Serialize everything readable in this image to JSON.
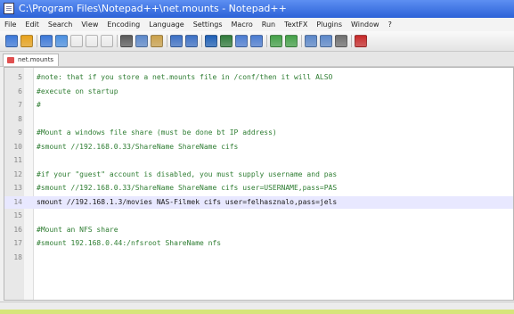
{
  "window": {
    "title": "C:\\Program Files\\Notepad++\\net.mounts - Notepad++"
  },
  "menu": [
    "File",
    "Edit",
    "Search",
    "View",
    "Encoding",
    "Language",
    "Settings",
    "Macro",
    "Run",
    "TextFX",
    "Plugins",
    "Window",
    "?"
  ],
  "toolbar": {
    "icons": [
      "new-file-icon",
      "open-icon",
      "save-icon",
      "save-all-icon",
      "close-icon",
      "close-all-icon",
      "print-icon",
      "cut-icon",
      "copy-icon",
      "paste-icon",
      "undo-icon",
      "redo-icon",
      "find-icon",
      "replace-icon",
      "zoom-in-icon",
      "zoom-out-icon",
      "sync-v-icon",
      "sync-h-icon",
      "wrap-icon",
      "indent-guide-icon",
      "user-lang-icon",
      "record-macro-icon"
    ]
  },
  "tab": {
    "label": "net.mounts"
  },
  "editor": {
    "lines": [
      {
        "num": "5",
        "text": "#note: that if you store a net.mounts file in /conf/then it will ALSO",
        "style": "comment"
      },
      {
        "num": "6",
        "text": "#execute on startup",
        "style": "comment"
      },
      {
        "num": "7",
        "text": "#",
        "style": "comment"
      },
      {
        "num": "8",
        "text": "",
        "style": "plain"
      },
      {
        "num": "9",
        "text": "#Mount a windows file share (must be done bt IP address)",
        "style": "comment"
      },
      {
        "num": "10",
        "text": "#smount //192.168.0.33/ShareName ShareName cifs",
        "style": "comment"
      },
      {
        "num": "11",
        "text": "",
        "style": "plain"
      },
      {
        "num": "12",
        "text": "#if your \"guest\" account is disabled, you must supply username and pas",
        "style": "comment"
      },
      {
        "num": "13",
        "text": "#smount //192.168.0.33/ShareName ShareName cifs user=USERNAME,pass=PAS",
        "style": "comment"
      },
      {
        "num": "14",
        "text": "smount //192.168.1.3/movies NAS-Filmek cifs user=felhasznalo,pass=jels",
        "style": "plain",
        "highlight": true
      },
      {
        "num": "15",
        "text": "",
        "style": "plain"
      },
      {
        "num": "16",
        "text": "#Mount an NFS share",
        "style": "comment"
      },
      {
        "num": "17",
        "text": "#smount 192.168.0.44:/nfsroot ShareName nfs",
        "style": "comment"
      },
      {
        "num": "18",
        "text": "",
        "style": "plain"
      }
    ]
  },
  "colors": {
    "titlebar": "#2c62d7",
    "comment": "#2e7d32",
    "background": "#d6e57a"
  }
}
